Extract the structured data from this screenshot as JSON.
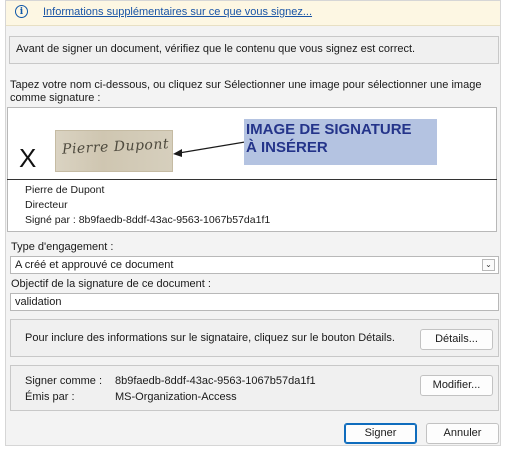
{
  "infobar": {
    "icon": "info-icon",
    "link": "Informations supplémentaires sur ce que vous signez..."
  },
  "warning": "Avant de signer un document, vérifiez que le contenu que vous signez est correct.",
  "instruction": "Tapez votre nom ci-dessous, ou cliquez sur Sélectionner une image pour sélectionner une image comme signature :",
  "signature": {
    "x_mark": "X",
    "image_text": "Pierre Dupont",
    "callout": "IMAGE DE SIGNATURE\nÀ INSÉRER",
    "signer_name": "Pierre de Dupont",
    "signer_title": "Directeur",
    "signed_by": "Signé par : 8b9faedb-8ddf-43ac-9563-1067b57da1f1"
  },
  "commitment": {
    "label": "Type d'engagement :",
    "value": "A créé et approuvé ce document"
  },
  "purpose": {
    "label": "Objectif de la signature de ce document :",
    "value": "validation"
  },
  "details": {
    "text": "Pour inclure des informations sur le signataire, cliquez sur le bouton Détails.",
    "button": "Détails..."
  },
  "identity": {
    "sign_as_label": "Signer comme :",
    "sign_as_value": "8b9faedb-8ddf-43ac-9563-1067b57da1f1",
    "issued_by_label": "Émis par :",
    "issued_by_value": "MS-Organization-Access",
    "modify_button": "Modifier..."
  },
  "actions": {
    "sign": "Signer",
    "cancel": "Annuler"
  },
  "colors": {
    "infobar_bg": "#fdf7e3",
    "link": "#1a55a6",
    "callout_bg": "#b4c3e1",
    "callout_text": "#24348a",
    "primary_border": "#0f6cbd"
  }
}
